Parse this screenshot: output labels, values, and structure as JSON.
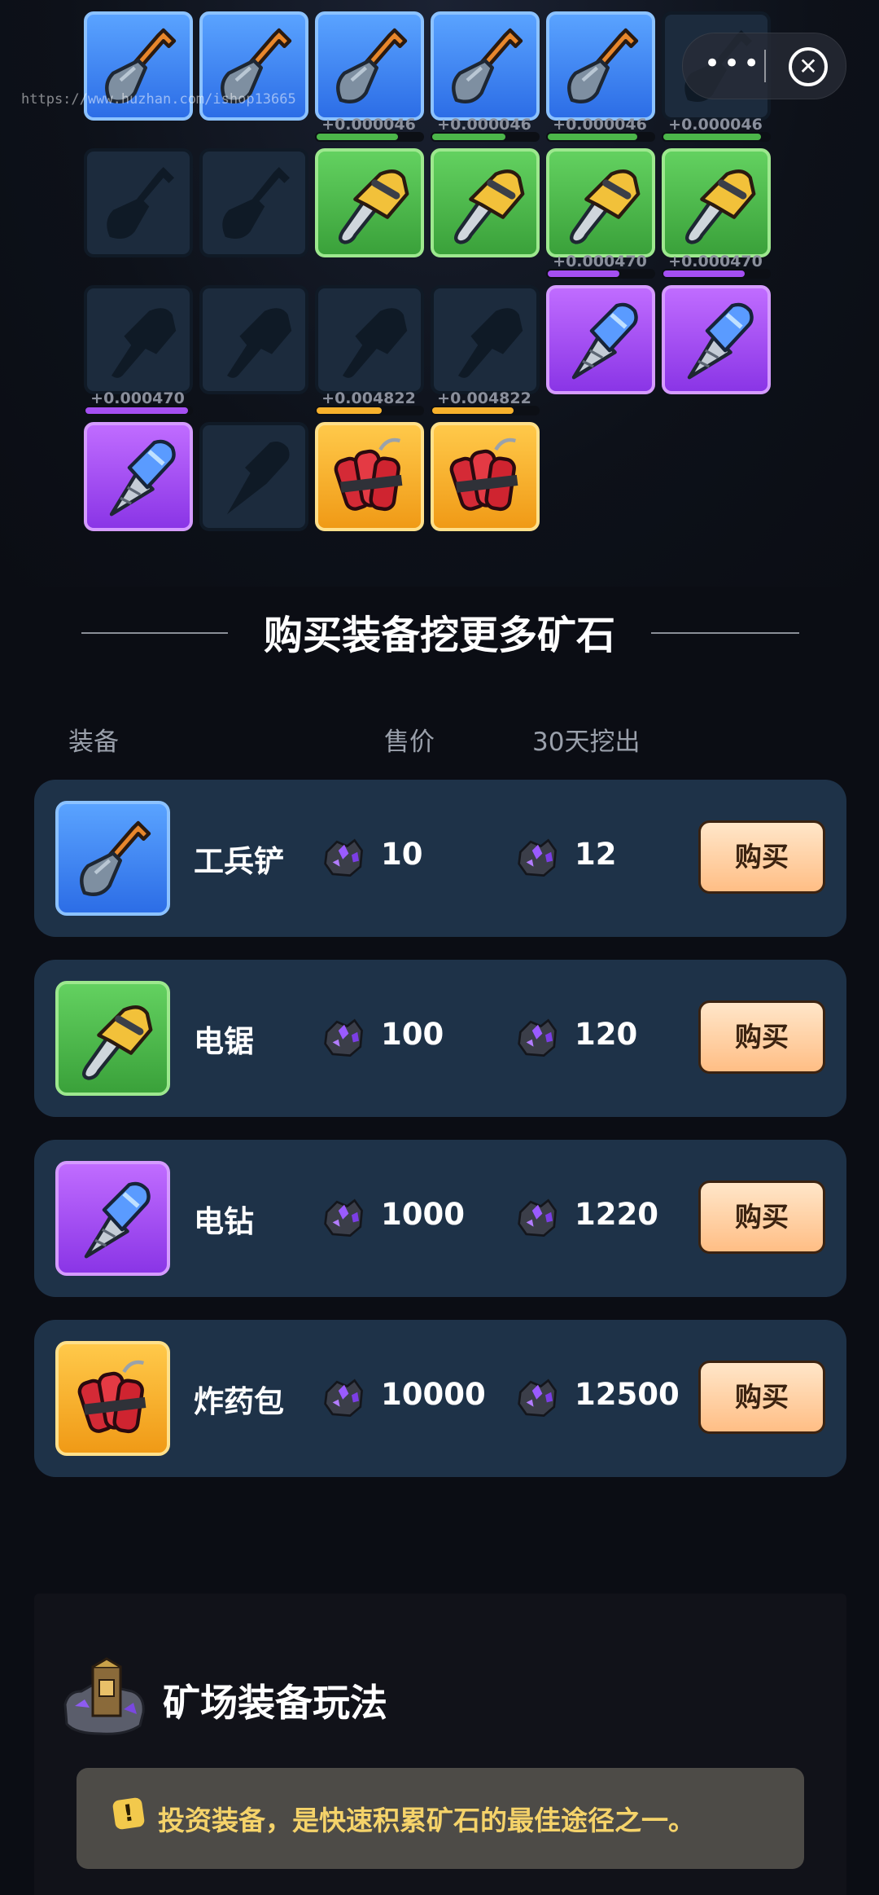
{
  "watermark": "https://www.huzhan.com/ishop13665",
  "capsule": {
    "menu_glyph": "•••",
    "close_glyph": "✕"
  },
  "grid_rates": {
    "row1": [
      "+0.000046",
      "+0.000046",
      "+0.000046",
      "+0.000046"
    ],
    "row2": [
      "+0.000470",
      "+0.000470"
    ],
    "row3": [
      "+0.000470",
      "+0.004822",
      "+0.004822"
    ]
  },
  "section": {
    "title": "购买装备挖更多矿石"
  },
  "columns": {
    "equipment": "装备",
    "price": "售价",
    "yield": "30天挖出"
  },
  "items": [
    {
      "name": "工兵铲",
      "price": "10",
      "yield": "12",
      "button": "购买",
      "tier_color": "#3f86f2",
      "icon": "shovel-icon"
    },
    {
      "name": "电锯",
      "price": "100",
      "yield": "120",
      "button": "购买",
      "tier_color": "#4cb64a",
      "icon": "chainsaw-icon"
    },
    {
      "name": "电钻",
      "price": "1000",
      "yield": "1220",
      "button": "购买",
      "tier_color": "#a54ff2",
      "icon": "drill-icon"
    },
    {
      "name": "炸药包",
      "price": "10000",
      "yield": "12500",
      "button": "购买",
      "tier_color": "#f7b12c",
      "icon": "dynamite-icon"
    }
  ],
  "panel": {
    "title": "矿场装备玩法",
    "tip_icon": "!",
    "tip": "投资装备，是快速积累矿石的最佳途径之一。"
  }
}
